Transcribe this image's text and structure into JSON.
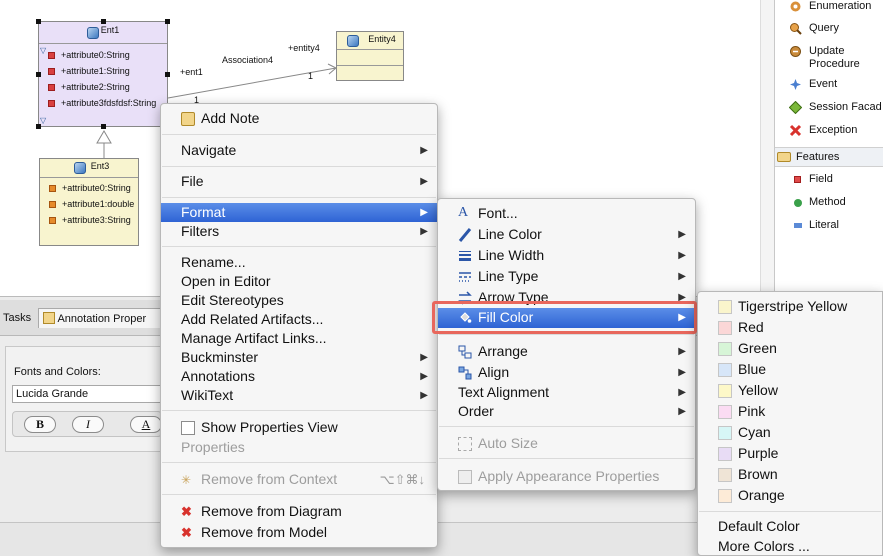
{
  "diagram": {
    "ent1": {
      "name": "Ent1",
      "attributes": [
        "+attribute0:String",
        "+attribute1:String",
        "+attribute2:String",
        "+attribute3fdsfdsf:String"
      ]
    },
    "entity4": {
      "name": "Entity4"
    },
    "ent3": {
      "name": "Ent3",
      "attributes": [
        "+attribute0:String",
        "+attribute1:double",
        "+attribute3:String"
      ]
    },
    "association": {
      "name": "Association4",
      "source_role": "+ent1",
      "target_role": "+entity4",
      "source_mult": "1",
      "target_mult": "1"
    }
  },
  "palette": {
    "items": [
      {
        "label": "Enumeration",
        "icon": "enumeration-icon"
      },
      {
        "label": "Query",
        "icon": "query-icon"
      },
      {
        "label": "Update",
        "label2": "Procedure",
        "icon": "update-procedure-icon"
      },
      {
        "label": "Event",
        "icon": "event-icon"
      },
      {
        "label": "Session Facad",
        "icon": "session-facade-icon"
      },
      {
        "label": "Exception",
        "icon": "exception-icon"
      }
    ],
    "section": "Features",
    "features": [
      {
        "label": "Field",
        "icon": "field-icon"
      },
      {
        "label": "Method",
        "icon": "method-icon"
      },
      {
        "label": "Literal",
        "icon": "literal-icon"
      }
    ]
  },
  "bottom_panel": {
    "tabs": [
      "Tasks",
      "Annotation Proper"
    ],
    "fonts_label": "Fonts and Colors:",
    "font_value": "Lucida Grande",
    "bold_btn": "B",
    "italic_btn": "I",
    "color_btn": "A"
  },
  "context_menu": {
    "items": {
      "add_note": "Add Note",
      "navigate": "Navigate",
      "file": "File",
      "format": "Format",
      "filters": "Filters",
      "rename": "Rename...",
      "open_editor": "Open in Editor",
      "edit_stereo": "Edit Stereotypes",
      "add_related": "Add Related Artifacts...",
      "manage_links": "Manage Artifact Links...",
      "buckminster": "Buckminster",
      "annotations": "Annotations",
      "wikitext": "WikiText",
      "show_props": "Show Properties View",
      "properties": "Properties",
      "remove_context": "Remove from Context",
      "remove_context_shortcut": "⌥⇧⌘↓",
      "remove_diagram": "Remove from Diagram",
      "remove_model": "Remove from Model"
    }
  },
  "format_menu": {
    "items": {
      "font": "Font...",
      "line_color": "Line Color",
      "line_width": "Line Width",
      "line_type": "Line Type",
      "arrow_type": "Arrow Type",
      "fill_color": "Fill Color",
      "arrange": "Arrange",
      "align": "Align",
      "text_alignment": "Text Alignment",
      "order": "Order",
      "auto_size": "Auto Size",
      "apply_appearance": "Apply Appearance Properties"
    }
  },
  "fill_color_menu": {
    "colors": [
      {
        "label": "Tigerstripe Yellow",
        "hex": "#faf5cc"
      },
      {
        "label": "Red",
        "hex": "#fbd7d7"
      },
      {
        "label": "Green",
        "hex": "#d7f5d7"
      },
      {
        "label": "Blue",
        "hex": "#d7e6f8"
      },
      {
        "label": "Yellow",
        "hex": "#fdf8c8"
      },
      {
        "label": "Pink",
        "hex": "#fbdcf3"
      },
      {
        "label": "Cyan",
        "hex": "#d7f6f6"
      },
      {
        "label": "Purple",
        "hex": "#e8dcf5"
      },
      {
        "label": "Brown",
        "hex": "#efe4d6"
      },
      {
        "label": "Orange",
        "hex": "#fdebd7"
      }
    ],
    "default_color": "Default Color",
    "more_colors": "More Colors ..."
  },
  "colors": {
    "menu_selection": "#3a6fdc",
    "ent1_fill": "#e9e0f8",
    "entity_fill": "#f8f4cf",
    "highlight_border": "#e8675c"
  }
}
